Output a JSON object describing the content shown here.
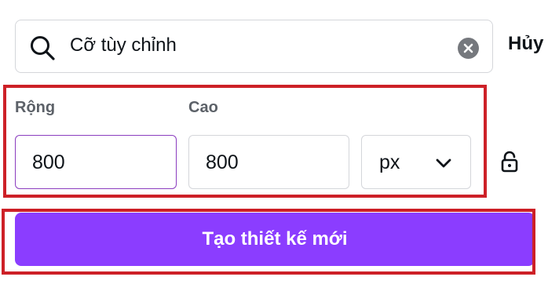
{
  "search": {
    "value": "Cỡ tùy chỉnh",
    "icon": "search-icon",
    "clear_icon": "clear-icon"
  },
  "cancel_label": "Hủy",
  "size_form": {
    "width_label": "Rộng",
    "width_value": "800",
    "height_label": "Cao",
    "height_value": "800",
    "unit_value": "px",
    "unit_icon": "chevron-down-icon",
    "lock_icon": "unlock-icon"
  },
  "create_button_label": "Tạo thiết kế mới",
  "colors": {
    "accent": "#8b3dff",
    "annotation": "#cd2027",
    "focus_border": "#8b3dbf"
  }
}
